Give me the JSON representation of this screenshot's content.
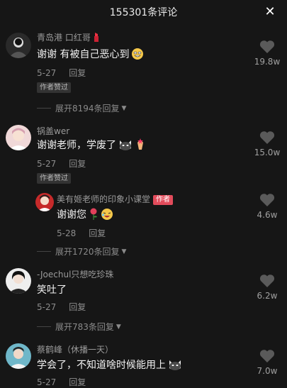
{
  "header": {
    "title": "155301条评论",
    "close_icon": "close-icon"
  },
  "comments": [
    {
      "user": "青岛港 口红哥",
      "text": "谢谢 有被自己恶心到",
      "date": "5-27",
      "reply": "回复",
      "badge": "作者赞过",
      "likes": "19.8w",
      "expand": "展开8194条回复"
    },
    {
      "user": "锅盖wer",
      "text": "谢谢老师，学废了",
      "date": "5-27",
      "reply": "回复",
      "badge": "作者赞过",
      "likes": "15.0w"
    },
    {
      "user": "美有姬老师的印象小课堂",
      "author_tag": "作者",
      "text": "谢谢您",
      "date": "5-28",
      "reply": "回复",
      "likes": "4.6w",
      "expand": "展开1720条回复"
    },
    {
      "user": "-Joechul只想吃珍珠",
      "text": "笑吐了",
      "date": "5-27",
      "reply": "回复",
      "likes": "6.2w",
      "expand": "展开783条回复"
    },
    {
      "user": "蔡鹤峰（休播一天）",
      "text": "学会了，不知道啥时候能用上",
      "date": "5-27",
      "reply": "回复",
      "likes": "7.0w"
    }
  ],
  "colors": {
    "background": "#161616",
    "author_tag": "#e24b5b"
  }
}
